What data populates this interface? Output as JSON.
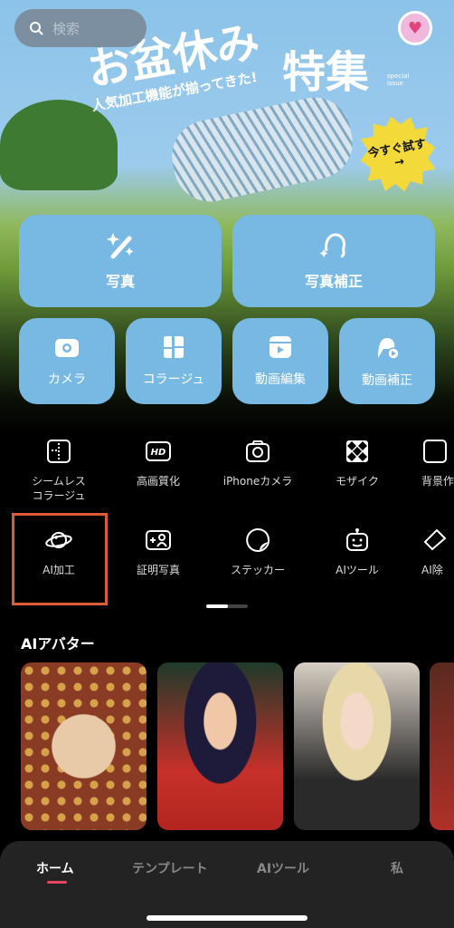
{
  "search": {
    "placeholder": "検索",
    "icon": "search-icon"
  },
  "banner": {
    "title_line1": "お盆休み",
    "title_line2": "特集",
    "subtitle": "人気加工機能が揃ってきた!",
    "special": "special issue",
    "cta": "今すぐ試す",
    "cta_arrow": "→"
  },
  "main_buttons": [
    {
      "label": "写真",
      "icon": "magic-wand-icon"
    },
    {
      "label": "写真補正",
      "icon": "face-retouch-icon"
    }
  ],
  "small_buttons": [
    {
      "label": "カメラ",
      "icon": "camera-icon"
    },
    {
      "label": "コラージュ",
      "icon": "collage-icon"
    },
    {
      "label": "動画編集",
      "icon": "video-edit-icon"
    },
    {
      "label": "動画補正",
      "icon": "video-retouch-icon"
    }
  ],
  "tools": [
    {
      "label": "シームレス\nコラージュ",
      "icon": "seamless-collage-icon"
    },
    {
      "label": "高画質化",
      "icon": "hd-icon"
    },
    {
      "label": "iPhoneカメラ",
      "icon": "camera-outline-icon"
    },
    {
      "label": "モザイク",
      "icon": "mosaic-icon"
    },
    {
      "label": "背景作",
      "icon": "background-icon"
    },
    {
      "label": "AI加工",
      "icon": "planet-icon"
    },
    {
      "label": "証明写真",
      "icon": "id-photo-icon"
    },
    {
      "label": "ステッカー",
      "icon": "sticker-icon"
    },
    {
      "label": "AIツール",
      "icon": "robot-icon"
    },
    {
      "label": "AI除",
      "icon": "eraser-icon"
    }
  ],
  "section": {
    "title": "AIアバター"
  },
  "tabs": [
    {
      "label": "ホーム",
      "active": true
    },
    {
      "label": "テンプレート"
    },
    {
      "label": "AIツール"
    },
    {
      "label": "私"
    }
  ],
  "colors": {
    "button": "#78b9e4",
    "highlight": "#e05a3a",
    "tab_underline": "#e8455e"
  }
}
